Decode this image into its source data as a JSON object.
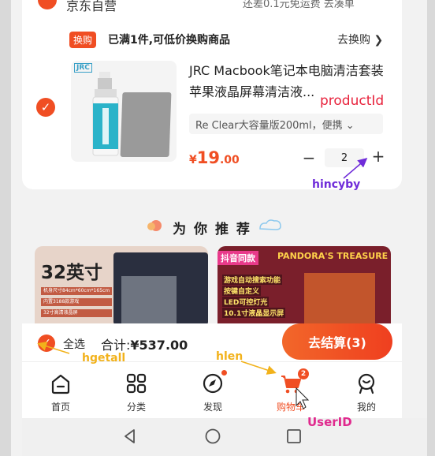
{
  "top_row": {
    "shop_name": "京东自营",
    "free_shipping": "还差0.1元免运费 去凑单"
  },
  "promo": {
    "tag": "换购",
    "text": "已满1件,可低价换购商品",
    "link": "去换购 ❯"
  },
  "product": {
    "logo_text": "JRC",
    "title": "JRC Macbook笔记本电脑清洁套装 苹果液晶屏幕清洁液...",
    "variant": "Re Clear大容量版200ml，便携 ⌄",
    "price_currency": "¥",
    "price_int": "19",
    "price_dec": ".00",
    "quantity": "2",
    "minus": "−",
    "plus": "+"
  },
  "annotations": {
    "product_id": "productId",
    "hincy": "hincyby",
    "hgetall": "hgetall",
    "hlen": "hlen",
    "user_id": "UserID"
  },
  "recommend": {
    "title": "为 你 推 荐",
    "card1": {
      "headline": "32英寸",
      "spec1": "机身尺寸84cm*60cm*165cm",
      "spec2": "内置3188款游戏",
      "spec3": "32寸高清液晶屏"
    },
    "card2": {
      "tag": "抖音同款",
      "banner": "PANDORA'S TREASURE",
      "feat1": "游戏自动搜索功能",
      "feat2": "按键自定义",
      "feat3": "LED可控灯光",
      "feat4": "10.1寸液晶显示屏"
    }
  },
  "settle": {
    "select_all": "全选",
    "total_label": "合计:",
    "total_amount": "¥537.00",
    "checkout": "去结算(3)"
  },
  "nav": {
    "items": [
      {
        "label": "首页",
        "icon": "home-icon"
      },
      {
        "label": "分类",
        "icon": "category-icon"
      },
      {
        "label": "发现",
        "icon": "compass-icon"
      },
      {
        "label": "购物车",
        "icon": "cart-icon"
      },
      {
        "label": "我的",
        "icon": "user-icon"
      }
    ],
    "cart_badge": "2"
  },
  "colors": {
    "accent": "#f04e23",
    "annotation_red": "#e8233d",
    "annotation_purple": "#6f2cd9",
    "annotation_yellow": "#f2b21b",
    "annotation_pink": "#e02a8e"
  }
}
